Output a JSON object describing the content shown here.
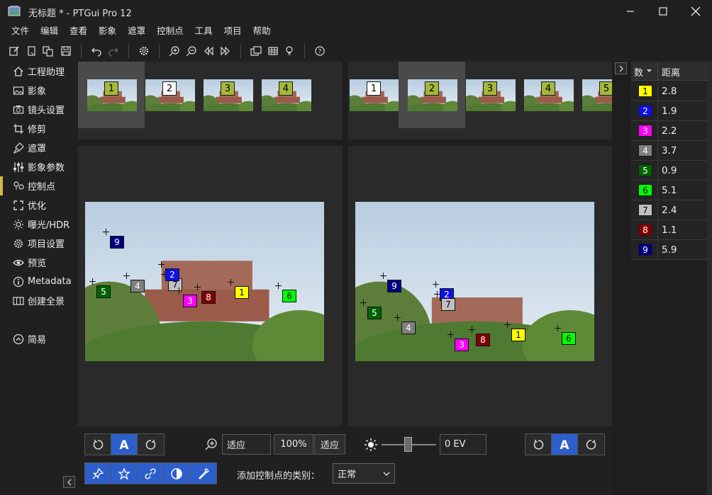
{
  "window": {
    "title": "无标题 * - PTGui Pro 12"
  },
  "menu": [
    "文件",
    "编辑",
    "查看",
    "影象",
    "遮罩",
    "控制点",
    "工具",
    "项目",
    "帮助"
  ],
  "sidebar": {
    "items": [
      {
        "label": "工程助理",
        "icon": "home-icon"
      },
      {
        "label": "影象",
        "icon": "image-icon"
      },
      {
        "label": "镜头设置",
        "icon": "camera-icon"
      },
      {
        "label": "修剪",
        "icon": "crop-icon"
      },
      {
        "label": "遮罩",
        "icon": "mask-brush-icon"
      },
      {
        "label": "影象参数",
        "icon": "sliders-icon"
      },
      {
        "label": "控制点",
        "icon": "control-points-icon"
      },
      {
        "label": "优化",
        "icon": "optimize-icon"
      },
      {
        "label": "曝光/HDR",
        "icon": "sun-icon"
      },
      {
        "label": "项目设置",
        "icon": "gear-icon"
      },
      {
        "label": "预览",
        "icon": "eye-icon"
      },
      {
        "label": "Metadata",
        "icon": "info-icon"
      },
      {
        "label": "创建全景",
        "icon": "panorama-icon"
      }
    ],
    "active_index": 6,
    "simple_label": "简易"
  },
  "left_strip": [
    "1",
    "2",
    "3",
    "4"
  ],
  "left_strip_selected": "1",
  "right_strip": [
    "1",
    "2",
    "3",
    "4",
    "5"
  ],
  "right_strip_selected": "2",
  "colors": {
    "1": "#ffff00",
    "2": "#1010e6",
    "3": "#ff00ff",
    "4": "#808080",
    "5": "#006400",
    "6": "#00ff00",
    "7": "#c0c0c0",
    "8": "#800000",
    "9": "#000080",
    "thumb_badge": "#a5b83a",
    "accent": "#2d5fcc"
  },
  "left_points": [
    "9",
    "4",
    "7",
    "2",
    "5",
    "8",
    "3",
    "1",
    "6"
  ],
  "right_points": [
    "9",
    "2",
    "7",
    "5",
    "4",
    "3",
    "8",
    "1",
    "6"
  ],
  "bottom": {
    "zoom_value": "适应",
    "zoom_100": "100%",
    "zoom_fit": "适应",
    "ev_value": "0 EV",
    "add_type_label": "添加控制点的类别：",
    "add_type_value": "正常"
  },
  "cp_table": {
    "col_num": "数",
    "col_dist": "距离",
    "rows": [
      {
        "id": "1",
        "dist": "2.8"
      },
      {
        "id": "2",
        "dist": "1.9"
      },
      {
        "id": "3",
        "dist": "2.2"
      },
      {
        "id": "4",
        "dist": "3.7"
      },
      {
        "id": "5",
        "dist": "0.9"
      },
      {
        "id": "6",
        "dist": "5.1"
      },
      {
        "id": "7",
        "dist": "2.4"
      },
      {
        "id": "8",
        "dist": "1.1"
      },
      {
        "id": "9",
        "dist": "5.9"
      }
    ]
  }
}
